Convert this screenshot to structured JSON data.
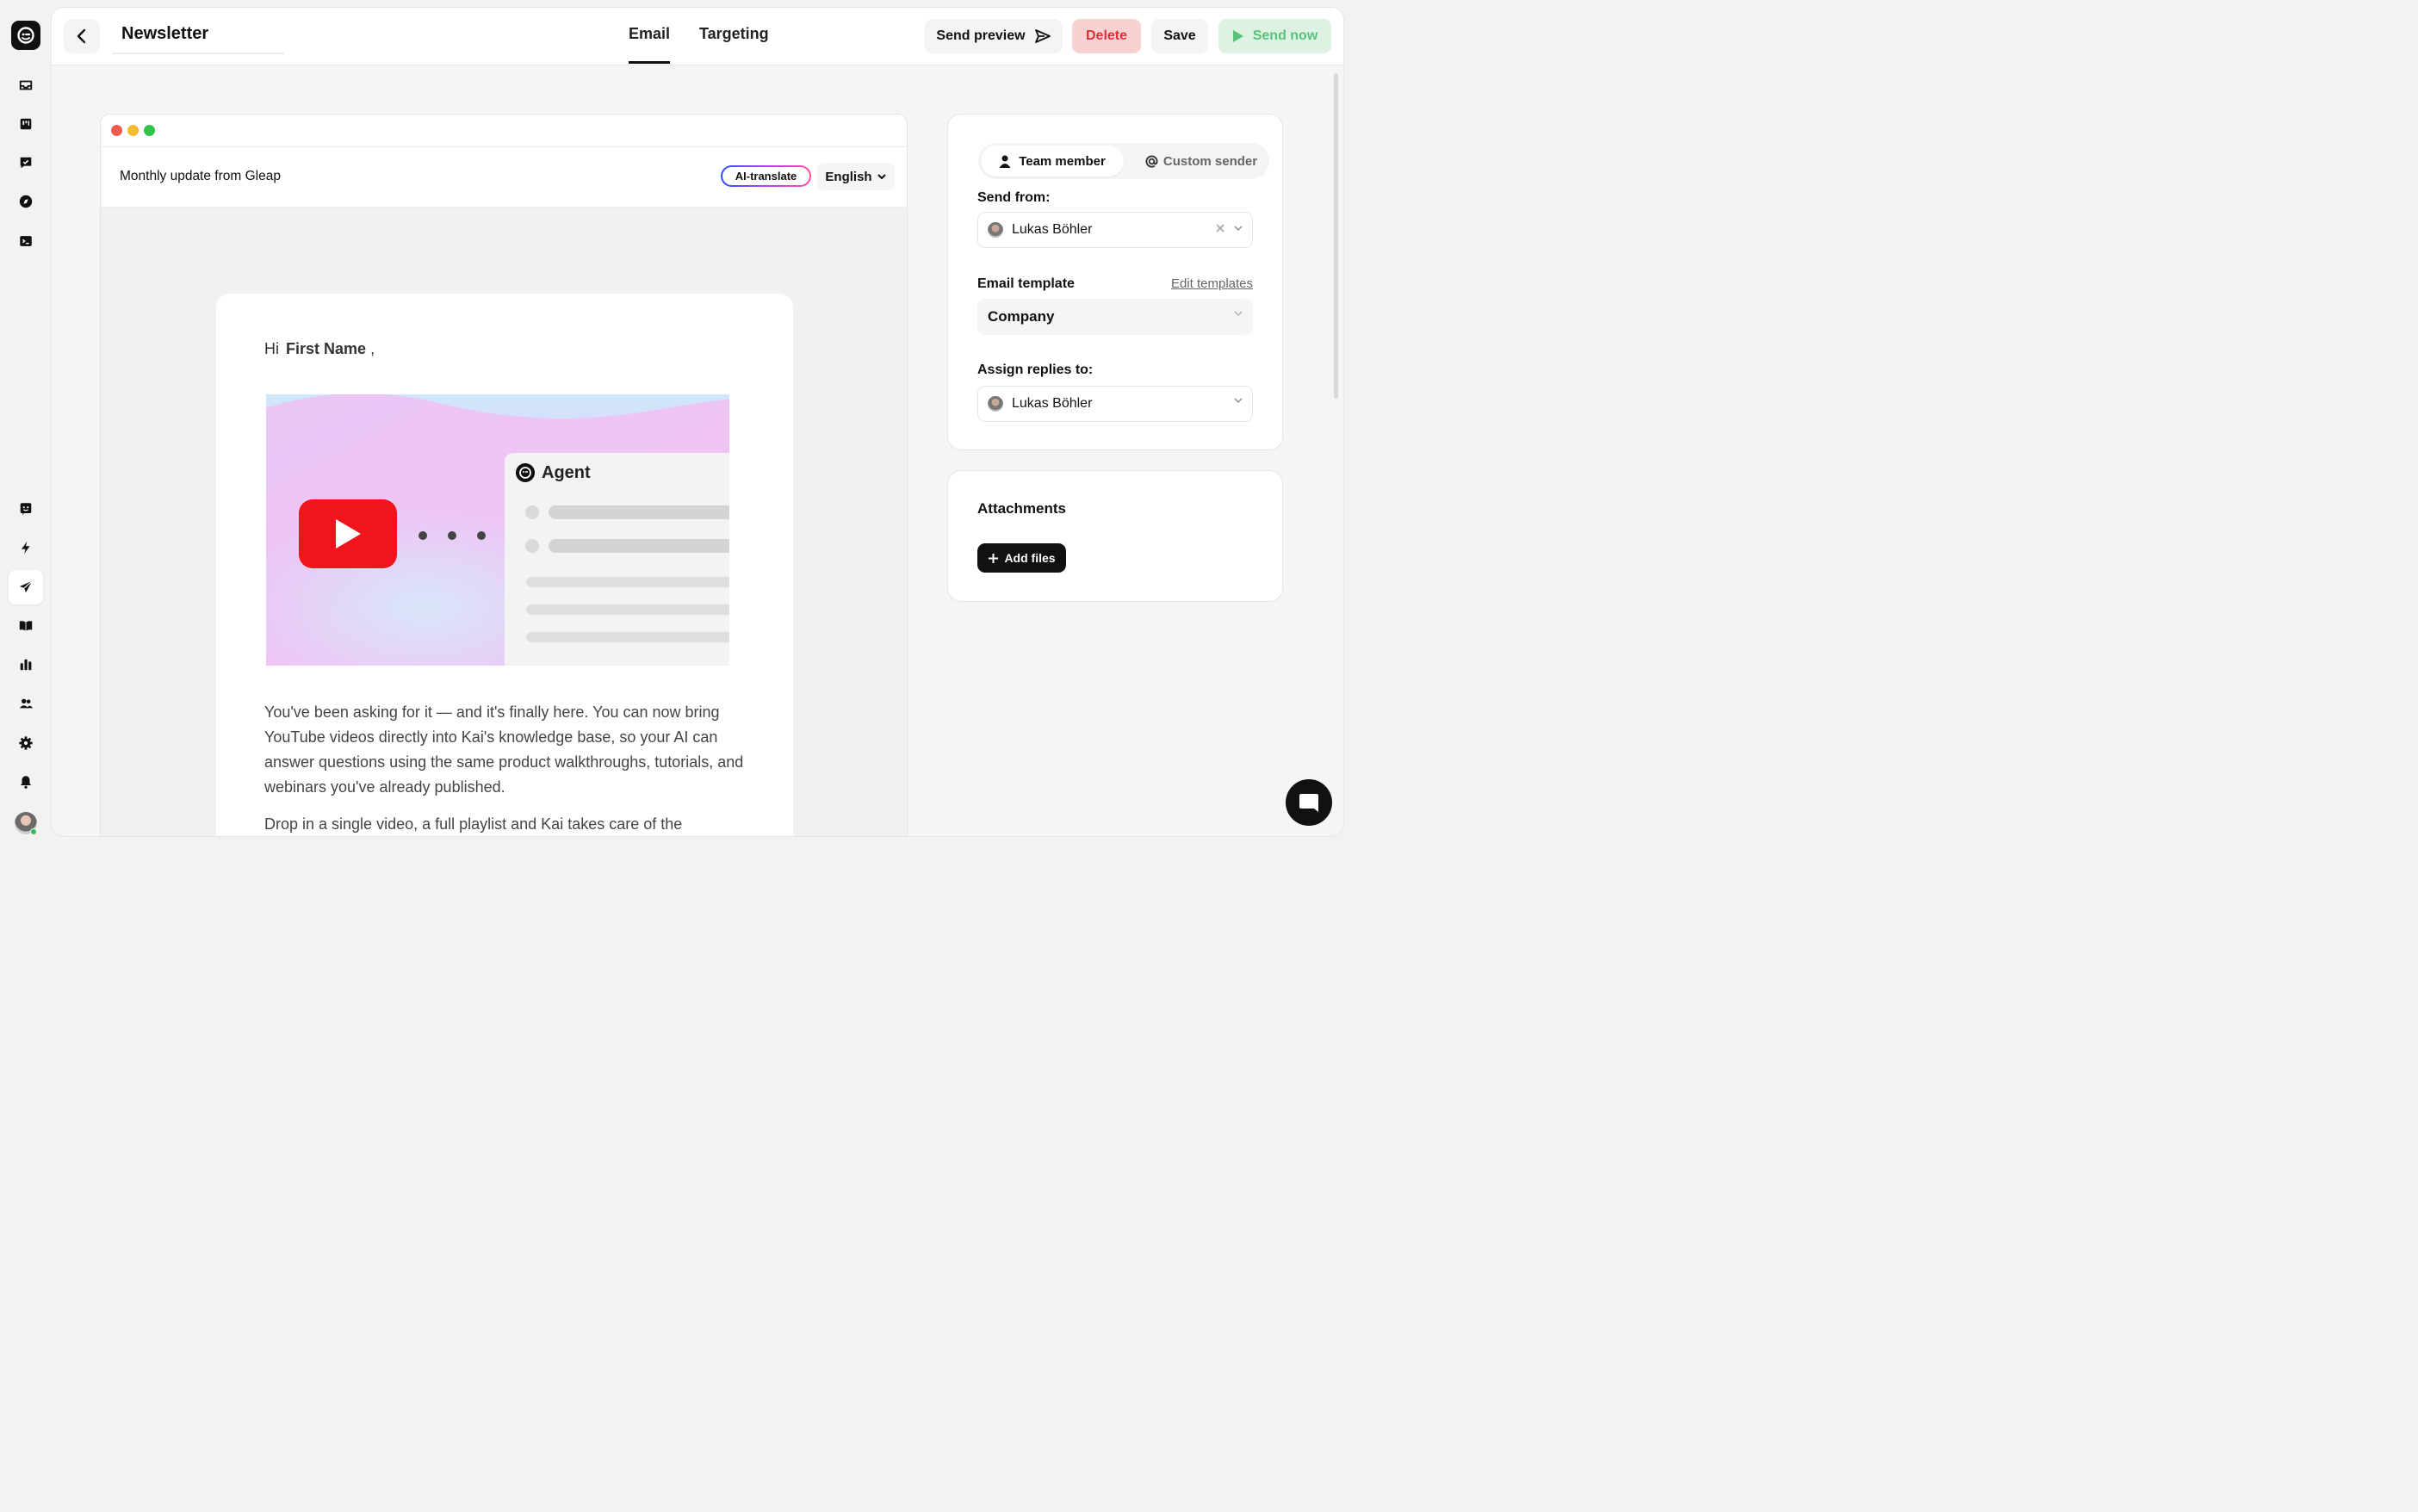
{
  "header": {
    "title": "Newsletter",
    "tabs": [
      {
        "label": "Email",
        "active": true
      },
      {
        "label": "Targeting",
        "active": false
      }
    ],
    "actions": {
      "preview": "Send preview",
      "delete": "Delete",
      "save": "Save",
      "send": "Send now"
    }
  },
  "sidebar": {
    "top_icons": [
      "inbox-icon",
      "board-icon",
      "check-chat-icon",
      "compass-icon",
      "terminal-icon"
    ],
    "bottom_icons": [
      "bot-icon",
      "bolt-icon",
      "send-icon",
      "book-icon",
      "chart-icon",
      "users-icon",
      "gear-icon",
      "bell-icon"
    ],
    "active": "send-icon"
  },
  "email": {
    "subject": "Monthly update from Gleap",
    "ai_translate": "AI-translate",
    "language": "English",
    "greeting": "Hi",
    "greeting_var": "First Name",
    "greeting_comma": ",",
    "agent_label": "Agent",
    "paragraph1": "You've been asking for it — and it's finally here. You can now bring YouTube videos directly into Kai's knowledge base, so your AI can answer questions using the same product walkthroughs, tutorials, and webinars you've already published.",
    "paragraph2": "Drop in a single video, a full playlist and Kai takes care of the"
  },
  "settings": {
    "sender_tabs": {
      "team": "Team member",
      "custom": "Custom sender"
    },
    "send_from_label": "Send from:",
    "send_from_value": "Lukas Böhler",
    "template_label": "Email template",
    "edit_templates": "Edit templates",
    "template_value": "Company",
    "assign_label": "Assign replies to:",
    "assign_value": "Lukas Böhler"
  },
  "attachments": {
    "title": "Attachments",
    "add_files": "Add files"
  },
  "colors": {
    "delete_bg": "#f8d2d2",
    "delete_text": "#e0303a",
    "send_bg": "#ddf2e3",
    "send_text": "#57c27a",
    "youtube_red": "#f1141b"
  }
}
